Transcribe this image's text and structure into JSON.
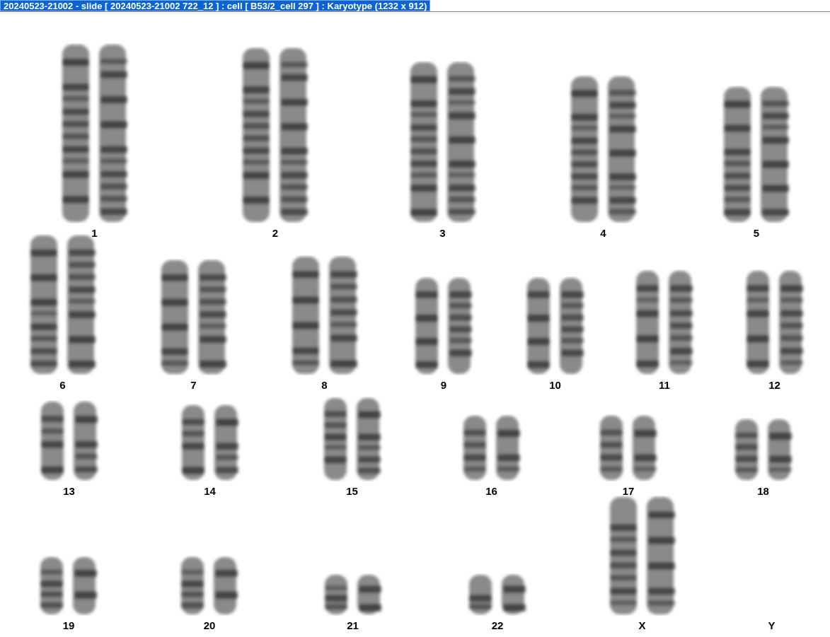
{
  "window": {
    "title": "20240523-21002 - slide [ 20240523-21002 722_12 ] : cell [ B53/2_cell 297 ] : Karyotype  (1232 x 912)"
  },
  "karyotype": {
    "rows": [
      [
        {
          "label": "1",
          "kind": "pair"
        },
        {
          "label": "2",
          "kind": "pair"
        },
        {
          "label": "3",
          "kind": "pair"
        },
        {
          "label": "4",
          "kind": "pair"
        },
        {
          "label": "5",
          "kind": "pair"
        }
      ],
      [
        {
          "label": "6",
          "kind": "pair"
        },
        {
          "label": "7",
          "kind": "pair"
        },
        {
          "label": "8",
          "kind": "pair"
        },
        {
          "label": "9",
          "kind": "pair"
        },
        {
          "label": "10",
          "kind": "pair"
        },
        {
          "label": "11",
          "kind": "pair"
        },
        {
          "label": "12",
          "kind": "pair"
        }
      ],
      [
        {
          "label": "13",
          "kind": "pair"
        },
        {
          "label": "14",
          "kind": "pair"
        },
        {
          "label": "15",
          "kind": "pair"
        },
        {
          "label": "16",
          "kind": "pair"
        },
        {
          "label": "17",
          "kind": "pair"
        },
        {
          "label": "18",
          "kind": "pair"
        }
      ],
      [
        {
          "label": "19",
          "kind": "pair"
        },
        {
          "label": "20",
          "kind": "pair"
        },
        {
          "label": "21",
          "kind": "pair"
        },
        {
          "label": "22",
          "kind": "pair"
        },
        {
          "label": "X",
          "kind": "pair"
        },
        {
          "label": "Y",
          "kind": "empty"
        }
      ]
    ]
  }
}
